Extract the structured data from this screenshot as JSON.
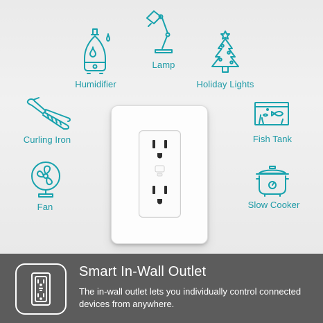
{
  "devices": [
    {
      "label": "Humidifier",
      "icon": "humidifier-icon"
    },
    {
      "label": "Lamp",
      "icon": "lamp-icon"
    },
    {
      "label": "Holiday Lights",
      "icon": "christmas-tree-icon"
    },
    {
      "label": "Curling Iron",
      "icon": "curling-iron-icon"
    },
    {
      "label": "Fish Tank",
      "icon": "fish-tank-icon"
    },
    {
      "label": "Fan",
      "icon": "fan-icon"
    },
    {
      "label": "Slow Cooker",
      "icon": "slow-cooker-icon"
    }
  ],
  "product": {
    "title": "Smart In-Wall Outlet",
    "description": "The in-wall outlet lets you individually control connected devices from anywhere.",
    "icon": "outlet-icon"
  },
  "colors": {
    "accent": "#17a2ad",
    "wall": "#ededed",
    "banner": "#5c5c5c"
  }
}
